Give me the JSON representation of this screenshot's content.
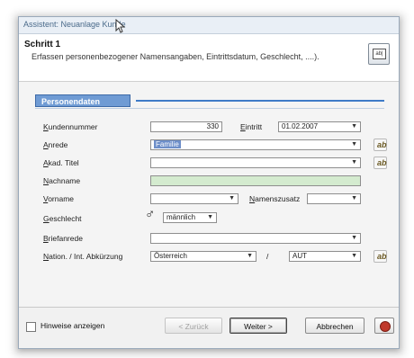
{
  "window": {
    "title": "Assistent: Neuanlage Kunde"
  },
  "header": {
    "step": "Schritt 1",
    "description": "Erfassen personenbezogener Namensangaben, Eintrittsdatum, Geschlecht, ....).",
    "button_icon": "text-icon"
  },
  "section": {
    "title": "Personendaten"
  },
  "form": {
    "kundennummer": {
      "label": "Kundennummer",
      "value": "330"
    },
    "eintritt": {
      "label": "Eintritt",
      "value": "01.02.2007"
    },
    "anrede": {
      "label": "Anrede",
      "value": "Familie"
    },
    "titel": {
      "label": "Akad. Titel",
      "value": ""
    },
    "nachname": {
      "label": "Nachname",
      "value": ""
    },
    "vorname": {
      "label": "Vorname",
      "value": ""
    },
    "namenszusatz": {
      "label": "Namenszusatz",
      "value": ""
    },
    "geschlecht": {
      "label": "Geschlecht",
      "value": "männlich",
      "icon": "male-icon"
    },
    "briefanrede": {
      "label": "Briefanrede",
      "value": ""
    },
    "nation": {
      "label": "Nation. / Int. Abkürzung",
      "value": "Österreich",
      "separator": "/",
      "abbr": "AUT"
    }
  },
  "footer": {
    "hints_label": "Hinweise anzeigen",
    "back_label": "< Zurück",
    "next_label": "Weiter >",
    "cancel_label": "Abbrechen"
  }
}
